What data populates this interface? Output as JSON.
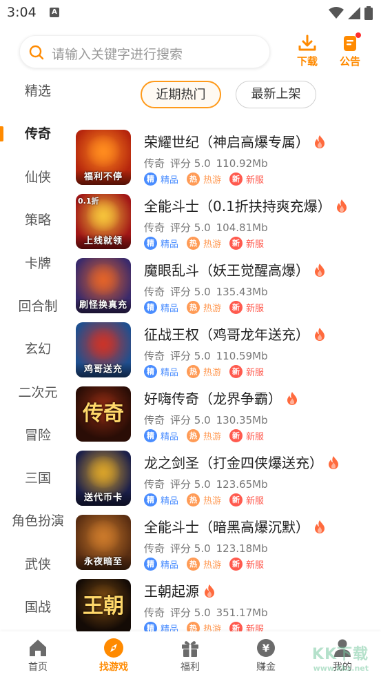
{
  "status_bar": {
    "time": "3:04",
    "notif_icon": "A"
  },
  "search": {
    "placeholder": "请输入关键字进行搜索"
  },
  "header": {
    "download_label": "下载",
    "notice_label": "公告"
  },
  "tabs": [
    {
      "label": "近期热门",
      "active": true
    },
    {
      "label": "最新上架",
      "active": false
    }
  ],
  "categories": [
    {
      "label": "精选"
    },
    {
      "label": "传奇",
      "active": true
    },
    {
      "label": "仙侠"
    },
    {
      "label": "策略"
    },
    {
      "label": "卡牌"
    },
    {
      "label": "回合制"
    },
    {
      "label": "玄幻"
    },
    {
      "label": "二次元"
    },
    {
      "label": "冒险"
    },
    {
      "label": "三国"
    },
    {
      "label": "角色扮演"
    },
    {
      "label": "武侠"
    },
    {
      "label": "国战"
    }
  ],
  "games": [
    {
      "name": "荣耀世纪（神启高爆专属）",
      "genre": "传奇",
      "rating": "评分 5.0",
      "size": "110.92Mb",
      "icon_text": "福利不停",
      "bg": "#b5250d",
      "accent": "#ff8b1e"
    },
    {
      "name": "全能斗士（0.1折扶持爽充爆）",
      "genre": "传奇",
      "rating": "评分 5.0",
      "size": "104.81Mb",
      "icon_text": "上线就领",
      "corner_text": "0.1折",
      "bg": "#a11616",
      "accent": "#f5c13a"
    },
    {
      "name": "魔眼乱斗（妖王觉醒高爆）",
      "genre": "传奇",
      "rating": "评分 5.0",
      "size": "135.43Mb",
      "icon_text": "刷怪换真充",
      "bg": "#3a2a6b",
      "accent": "#e0622a"
    },
    {
      "name": "征战王权（鸡哥龙年送充）",
      "genre": "传奇",
      "rating": "评分 5.0",
      "size": "110.59Mb",
      "icon_text": "鸡哥送充",
      "bg": "#1f4f8f",
      "accent": "#c8342a"
    },
    {
      "name": "好嗨传奇（龙界争霸）",
      "genre": "传奇",
      "rating": "评分 5.0",
      "size": "130.35Mb",
      "icon_text": "",
      "glyph": "传奇",
      "bg": "#2a0d06",
      "accent": "#8a2a12"
    },
    {
      "name": "龙之剑圣（打金四侠爆送充）",
      "genre": "传奇",
      "rating": "评分 5.0",
      "size": "123.65Mb",
      "icon_text": "送代币卡",
      "bg": "#1b1f4a",
      "accent": "#d6a12a"
    },
    {
      "name": "全能斗士（暗黑高爆沉默）",
      "genre": "传奇",
      "rating": "评分 5.0",
      "size": "123.18Mb",
      "icon_text": "永夜暗至",
      "bg": "#5a2e12",
      "accent": "#c9782a"
    },
    {
      "name": "王朝起源",
      "genre": "传奇",
      "rating": "评分 5.0",
      "size": "351.17Mb",
      "icon_text": "",
      "glyph": "王朝",
      "bg": "#140b06",
      "accent": "#7a4a12"
    }
  ],
  "tags": [
    {
      "badge": "精",
      "text": "精品"
    },
    {
      "badge": "热",
      "text": "热游"
    },
    {
      "badge": "新",
      "text": "新服"
    }
  ],
  "bottom_nav": [
    {
      "label": "首页",
      "icon": "home-icon"
    },
    {
      "label": "找游戏",
      "icon": "compass-icon",
      "active": true
    },
    {
      "label": "福利",
      "icon": "gift-icon"
    },
    {
      "label": "赚金",
      "icon": "coin-icon"
    },
    {
      "label": "我的",
      "icon": "user-icon"
    }
  ],
  "colors": {
    "accent": "#ff8a00",
    "tag_blue": "#4a8dff",
    "tag_orange": "#ff9b56",
    "tag_red": "#ff5a4e"
  }
}
